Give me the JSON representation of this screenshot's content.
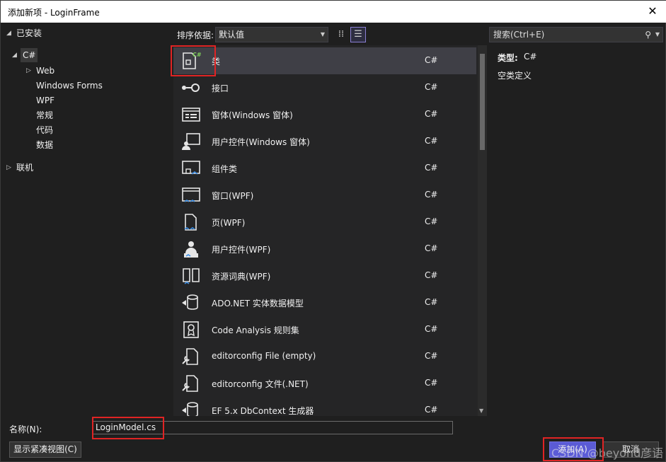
{
  "window": {
    "title": "添加新项 - LoginFrame",
    "close_glyph": "✕"
  },
  "tree": {
    "installed": "已安装",
    "csharp": "C#",
    "children": [
      "Web",
      "Windows Forms",
      "WPF",
      "常规",
      "代码",
      "数据"
    ],
    "online": "联机"
  },
  "toolbar": {
    "sort_label": "排序依据:",
    "sort_value": "默认值",
    "search_placeholder": "搜索(Ctrl+E)"
  },
  "items": [
    {
      "name": "类",
      "lang": "C#",
      "icon": "class-icon"
    },
    {
      "name": "接口",
      "lang": "C#",
      "icon": "interface-icon"
    },
    {
      "name": "窗体(Windows 窗体)",
      "lang": "C#",
      "icon": "form-icon"
    },
    {
      "name": "用户控件(Windows 窗体)",
      "lang": "C#",
      "icon": "user-control-icon"
    },
    {
      "name": "组件类",
      "lang": "C#",
      "icon": "component-class-icon"
    },
    {
      "name": "窗口(WPF)",
      "lang": "C#",
      "icon": "wpf-window-icon"
    },
    {
      "name": "页(WPF)",
      "lang": "C#",
      "icon": "wpf-page-icon"
    },
    {
      "name": "用户控件(WPF)",
      "lang": "C#",
      "icon": "wpf-user-control-icon"
    },
    {
      "name": "资源词典(WPF)",
      "lang": "C#",
      "icon": "resource-dictionary-icon"
    },
    {
      "name": "ADO.NET 实体数据模型",
      "lang": "C#",
      "icon": "entity-model-icon"
    },
    {
      "name": "Code Analysis 规则集",
      "lang": "C#",
      "icon": "ruleset-icon"
    },
    {
      "name": "editorconfig File (empty)",
      "lang": "C#",
      "icon": "editorconfig-icon"
    },
    {
      "name": "editorconfig 文件(.NET)",
      "lang": "C#",
      "icon": "editorconfig-icon"
    },
    {
      "name": "EF 5.x DbContext 生成器",
      "lang": "C#",
      "icon": "dbcontext-icon"
    }
  ],
  "detail": {
    "type_label": "类型:",
    "type_value": "C#",
    "description": "空类定义"
  },
  "bottom": {
    "name_label": "名称(N):",
    "name_value": "LoginModel.cs",
    "compact_button": "显示紧凑视图(C)",
    "add_button": "添加(A)",
    "cancel_button": "取消",
    "watermark": "CSDN @beyond彦语"
  },
  "colors": {
    "accent": "#5b5bd6",
    "highlight": "#e02424",
    "csharp_badge": "#7fd05a",
    "icon_blue": "#3a8ee6"
  }
}
